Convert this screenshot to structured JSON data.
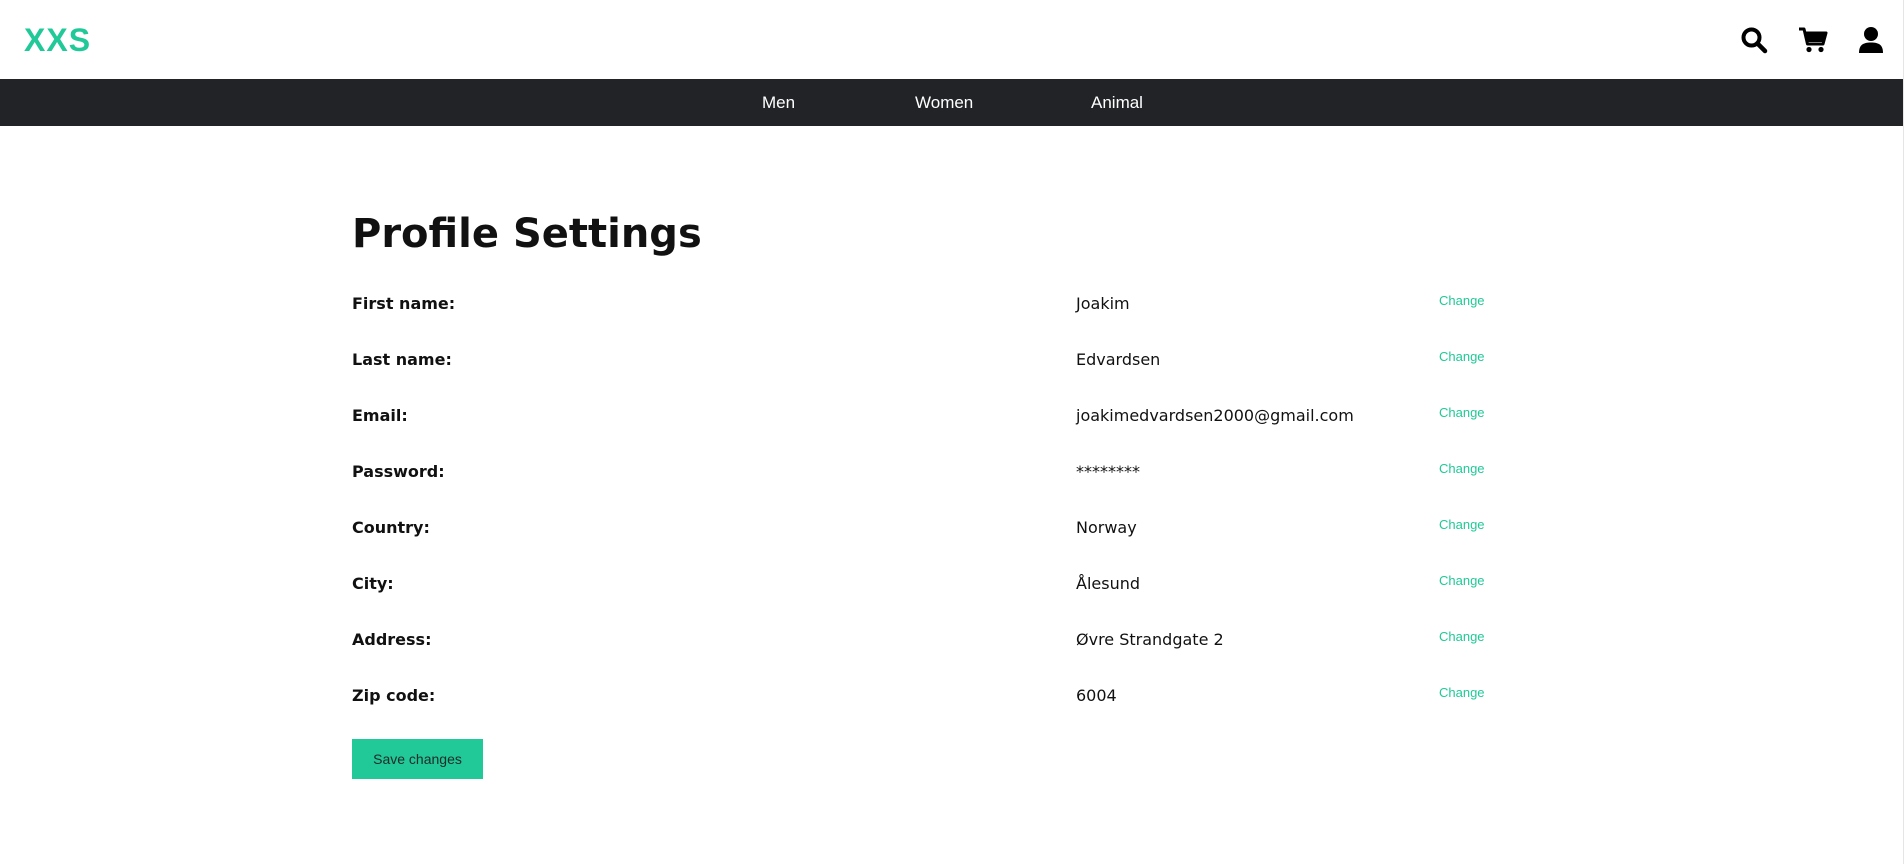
{
  "header": {
    "logo": "XXS",
    "icons": [
      "search-icon",
      "cart-icon",
      "user-icon"
    ]
  },
  "nav": {
    "items": [
      {
        "label": "Men"
      },
      {
        "label": "Women"
      },
      {
        "label": "Animal"
      }
    ]
  },
  "main": {
    "title": "Profile Settings",
    "fields": [
      {
        "label": "First name:",
        "value": "Joakim",
        "action": "Change"
      },
      {
        "label": "Last name:",
        "value": "Edvardsen",
        "action": "Change"
      },
      {
        "label": "Email:",
        "value": "joakimedvardsen2000@gmail.com",
        "action": "Change"
      },
      {
        "label": "Password:",
        "value": "********",
        "action": "Change"
      },
      {
        "label": "Country:",
        "value": "Norway",
        "action": "Change"
      },
      {
        "label": "City:",
        "value": "Ålesund",
        "action": "Change"
      },
      {
        "label": "Address:",
        "value": "Øvre Strandgate 2",
        "action": "Change"
      },
      {
        "label": "Zip code:",
        "value": "6004",
        "action": "Change"
      }
    ],
    "save_label": "Save changes"
  },
  "colors": {
    "accent": "#20c997",
    "navbar": "#212327"
  }
}
